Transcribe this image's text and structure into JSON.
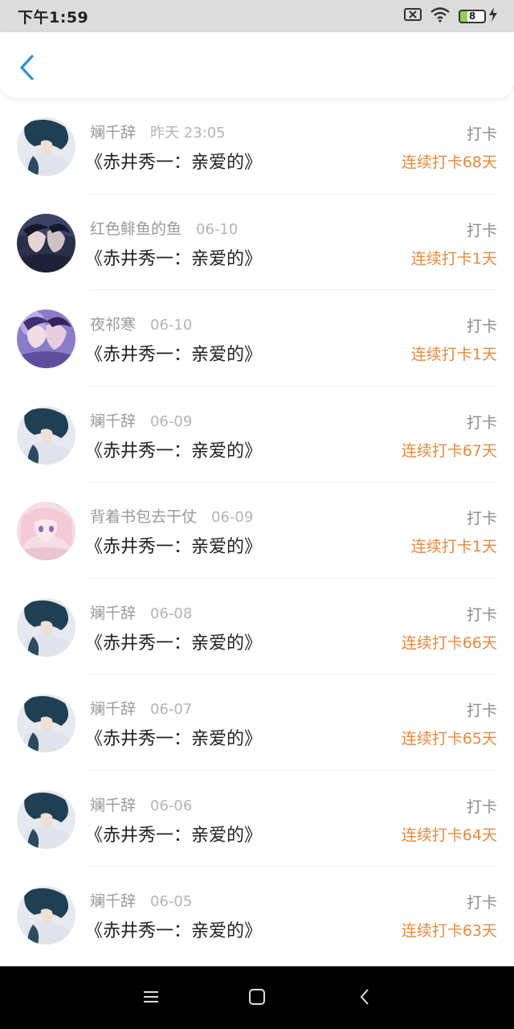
{
  "status_bar": {
    "time": "下午1:59",
    "battery_level": "8",
    "icons": [
      "sim-off-icon",
      "wifi-icon",
      "battery-icon",
      "charging-bolt-icon"
    ]
  },
  "header": {
    "back_icon": "chevron-left-icon",
    "accent_color": "#2a93d5"
  },
  "colors": {
    "streak": "#e8893b",
    "username": "#9a9a9a",
    "date": "#b5b5b5"
  },
  "entries": [
    {
      "user": "斓千辞",
      "date": "昨天 23:05",
      "title": "《赤井秀一：亲爱的》",
      "action": "打卡",
      "streak": "连续打卡68天",
      "avatar": "avatar-blue-hair"
    },
    {
      "user": "红色鲱鱼的鱼",
      "date": "06-10",
      "title": "《赤井秀一：亲爱的》",
      "action": "打卡",
      "streak": "连续打卡1天",
      "avatar": "avatar-dark-couple"
    },
    {
      "user": "夜祁寒",
      "date": "06-10",
      "title": "《赤井秀一：亲爱的》",
      "action": "打卡",
      "streak": "连续打卡1天",
      "avatar": "avatar-purple-couple"
    },
    {
      "user": "斓千辞",
      "date": "06-09",
      "title": "《赤井秀一：亲爱的》",
      "action": "打卡",
      "streak": "连续打卡67天",
      "avatar": "avatar-blue-hair"
    },
    {
      "user": "背着书包去干仗",
      "date": "06-09",
      "title": "《赤井秀一：亲爱的》",
      "action": "打卡",
      "streak": "连续打卡1天",
      "avatar": "avatar-pink-girl"
    },
    {
      "user": "斓千辞",
      "date": "06-08",
      "title": "《赤井秀一：亲爱的》",
      "action": "打卡",
      "streak": "连续打卡66天",
      "avatar": "avatar-blue-hair"
    },
    {
      "user": "斓千辞",
      "date": "06-07",
      "title": "《赤井秀一：亲爱的》",
      "action": "打卡",
      "streak": "连续打卡65天",
      "avatar": "avatar-blue-hair"
    },
    {
      "user": "斓千辞",
      "date": "06-06",
      "title": "《赤井秀一：亲爱的》",
      "action": "打卡",
      "streak": "连续打卡64天",
      "avatar": "avatar-blue-hair"
    },
    {
      "user": "斓千辞",
      "date": "06-05",
      "title": "《赤井秀一：亲爱的》",
      "action": "打卡",
      "streak": "连续打卡63天",
      "avatar": "avatar-blue-hair"
    }
  ],
  "nav_bar": {
    "icons": [
      "menu-icon",
      "home-square-icon",
      "back-triangle-icon"
    ]
  }
}
